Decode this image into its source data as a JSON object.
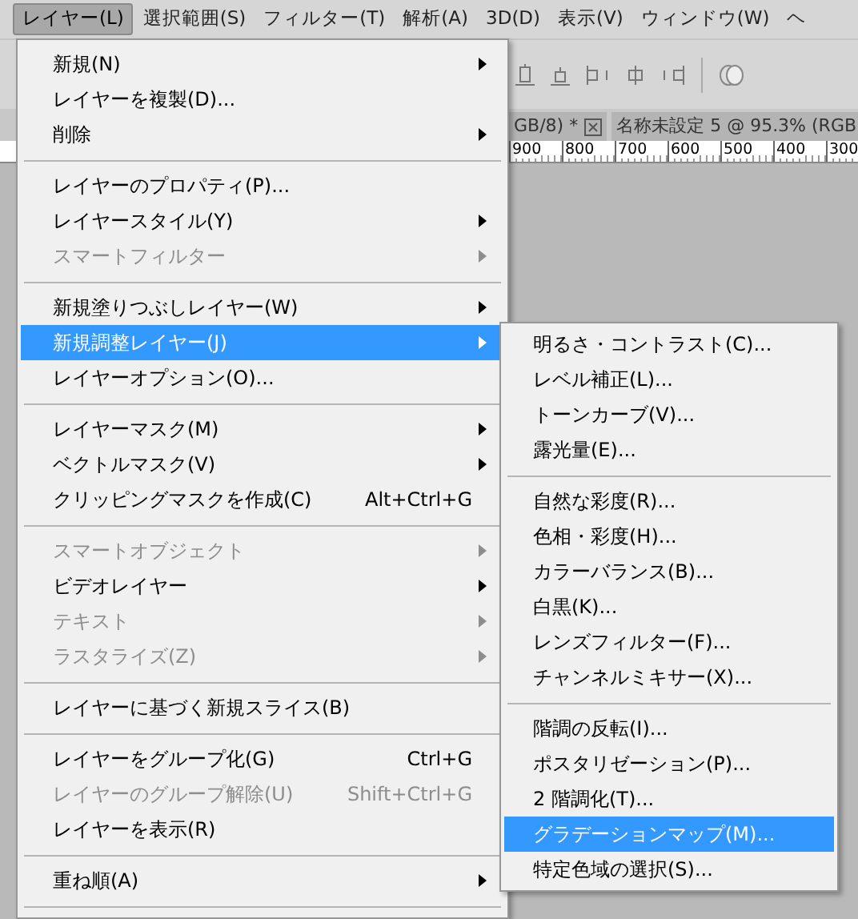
{
  "menubar": [
    {
      "label": "レイヤー(L)",
      "selected": true
    },
    {
      "label": "選択範囲(S)",
      "selected": false
    },
    {
      "label": "フィルター(T)",
      "selected": false
    },
    {
      "label": "解析(A)",
      "selected": false
    },
    {
      "label": "3D(D)",
      "selected": false
    },
    {
      "label": "表示(V)",
      "selected": false
    },
    {
      "label": "ウィンドウ(W)",
      "selected": false
    },
    {
      "label": "ヘ",
      "selected": false
    }
  ],
  "document_tabs": [
    {
      "label": "GB/8) *",
      "closable": true
    },
    {
      "label": "名称未設定 5 @ 95.3% (RGB",
      "closable": false
    }
  ],
  "ruler": [
    "900",
    "800",
    "700",
    "600",
    "500",
    "400",
    "300"
  ],
  "layer_menu": [
    {
      "kind": "item",
      "label": "新規(N)",
      "submenu": true,
      "disabled": false,
      "selected": false
    },
    {
      "kind": "item",
      "label": "レイヤーを複製(D)...",
      "submenu": false,
      "disabled": false,
      "selected": false
    },
    {
      "kind": "item",
      "label": "削除",
      "submenu": true,
      "disabled": false,
      "selected": false
    },
    {
      "kind": "separator"
    },
    {
      "kind": "item",
      "label": "レイヤーのプロパティ(P)...",
      "submenu": false,
      "disabled": false,
      "selected": false
    },
    {
      "kind": "item",
      "label": "レイヤースタイル(Y)",
      "submenu": true,
      "disabled": false,
      "selected": false
    },
    {
      "kind": "item",
      "label": "スマートフィルター",
      "submenu": true,
      "disabled": true,
      "selected": false
    },
    {
      "kind": "separator"
    },
    {
      "kind": "item",
      "label": "新規塗りつぶしレイヤー(W)",
      "submenu": true,
      "disabled": false,
      "selected": false
    },
    {
      "kind": "item",
      "label": "新規調整レイヤー(J)",
      "submenu": true,
      "disabled": false,
      "selected": true
    },
    {
      "kind": "item",
      "label": "レイヤーオプション(O)...",
      "submenu": false,
      "disabled": false,
      "selected": false
    },
    {
      "kind": "separator"
    },
    {
      "kind": "item",
      "label": "レイヤーマスク(M)",
      "submenu": true,
      "disabled": false,
      "selected": false
    },
    {
      "kind": "item",
      "label": "ベクトルマスク(V)",
      "submenu": true,
      "disabled": false,
      "selected": false
    },
    {
      "kind": "item",
      "label": "クリッピングマスクを作成(C)",
      "shortcut": "Alt+Ctrl+G",
      "submenu": false,
      "disabled": false,
      "selected": false
    },
    {
      "kind": "separator"
    },
    {
      "kind": "item",
      "label": "スマートオブジェクト",
      "submenu": true,
      "disabled": true,
      "selected": false
    },
    {
      "kind": "item",
      "label": "ビデオレイヤー",
      "submenu": true,
      "disabled": false,
      "selected": false
    },
    {
      "kind": "item",
      "label": "テキスト",
      "submenu": true,
      "disabled": true,
      "selected": false
    },
    {
      "kind": "item",
      "label": "ラスタライズ(Z)",
      "submenu": true,
      "disabled": true,
      "selected": false
    },
    {
      "kind": "separator"
    },
    {
      "kind": "item",
      "label": "レイヤーに基づく新規スライス(B)",
      "submenu": false,
      "disabled": false,
      "selected": false
    },
    {
      "kind": "separator"
    },
    {
      "kind": "item",
      "label": "レイヤーをグループ化(G)",
      "shortcut": "Ctrl+G",
      "submenu": false,
      "disabled": false,
      "selected": false
    },
    {
      "kind": "item",
      "label": "レイヤーのグループ解除(U)",
      "shortcut": "Shift+Ctrl+G",
      "submenu": false,
      "disabled": true,
      "selected": false
    },
    {
      "kind": "item",
      "label": "レイヤーを表示(R)",
      "submenu": false,
      "disabled": false,
      "selected": false
    },
    {
      "kind": "separator"
    },
    {
      "kind": "item",
      "label": "重ね順(A)",
      "submenu": true,
      "disabled": false,
      "selected": false
    },
    {
      "kind": "separator"
    }
  ],
  "adjustment_submenu": [
    {
      "kind": "item",
      "label": "明るさ・コントラスト(C)...",
      "selected": false
    },
    {
      "kind": "item",
      "label": "レベル補正(L)...",
      "selected": false
    },
    {
      "kind": "item",
      "label": "トーンカーブ(V)...",
      "selected": false
    },
    {
      "kind": "item",
      "label": "露光量(E)...",
      "selected": false
    },
    {
      "kind": "separator"
    },
    {
      "kind": "item",
      "label": "自然な彩度(R)...",
      "selected": false
    },
    {
      "kind": "item",
      "label": "色相・彩度(H)...",
      "selected": false
    },
    {
      "kind": "item",
      "label": "カラーバランス(B)...",
      "selected": false
    },
    {
      "kind": "item",
      "label": "白黒(K)...",
      "selected": false
    },
    {
      "kind": "item",
      "label": "レンズフィルター(F)...",
      "selected": false
    },
    {
      "kind": "item",
      "label": "チャンネルミキサー(X)...",
      "selected": false
    },
    {
      "kind": "separator"
    },
    {
      "kind": "item",
      "label": "階調の反転(I)...",
      "selected": false
    },
    {
      "kind": "item",
      "label": "ポスタリゼーション(P)...",
      "selected": false
    },
    {
      "kind": "item",
      "label": "2 階調化(T)...",
      "selected": false
    },
    {
      "kind": "item",
      "label": "グラデーションマップ(M)...",
      "selected": true
    },
    {
      "kind": "item",
      "label": "特定色域の選択(S)...",
      "selected": false
    }
  ]
}
